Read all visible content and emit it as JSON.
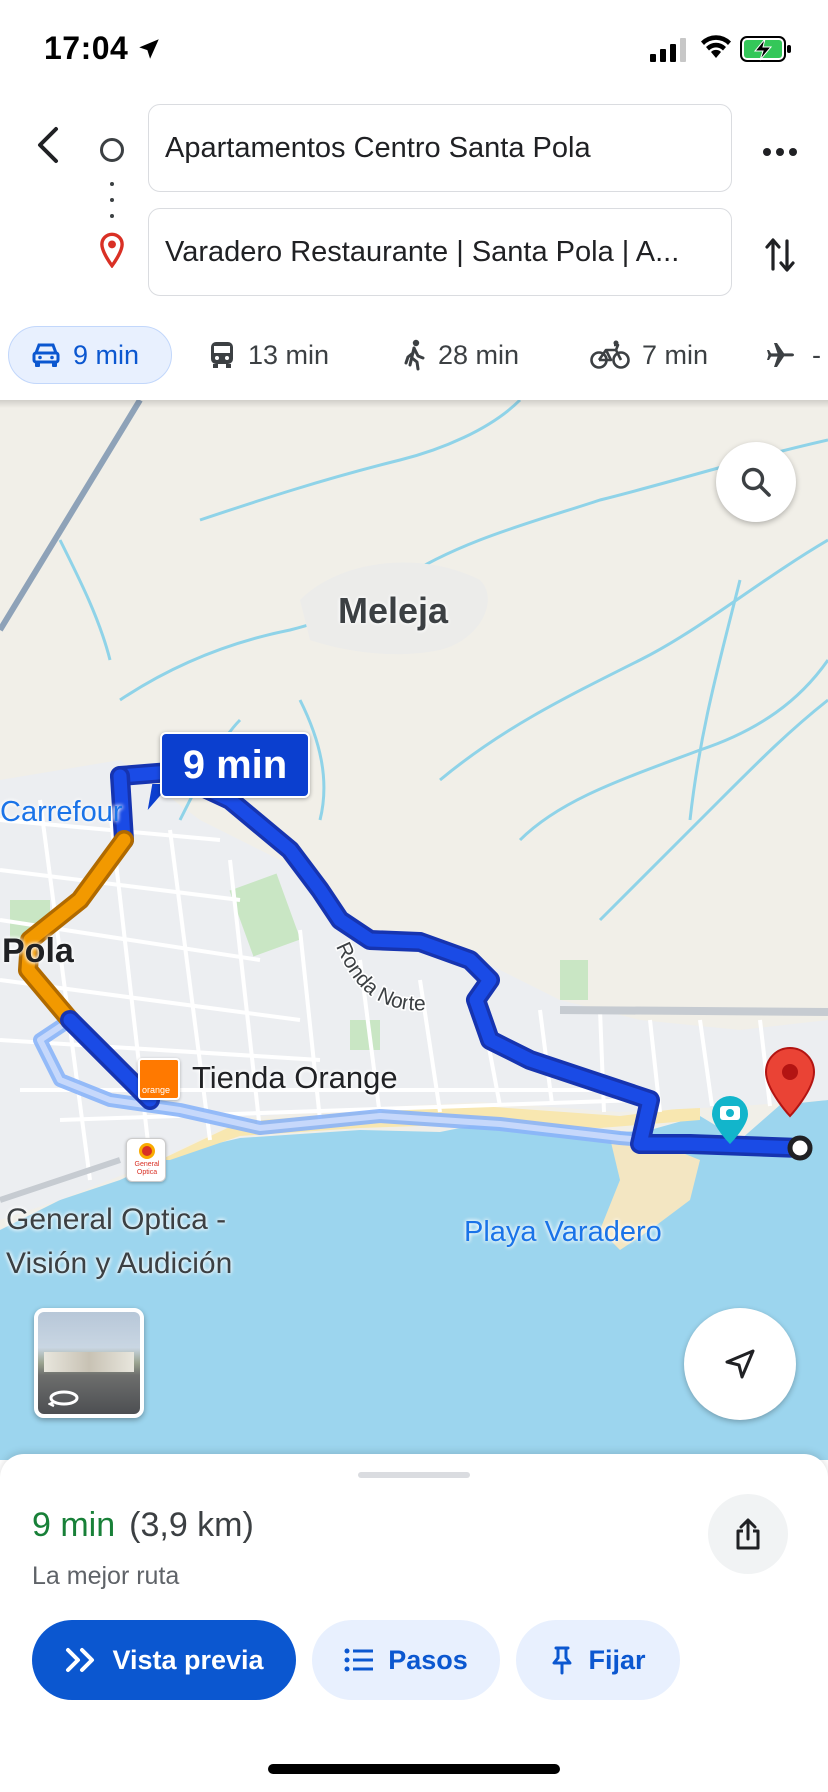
{
  "status_bar": {
    "time": "17:04"
  },
  "search": {
    "origin": "Apartamentos Centro Santa Pola",
    "destination": "Varadero Restaurante | Santa Pola | A..."
  },
  "modes": [
    {
      "name": "car",
      "label": "9 min",
      "selected": true
    },
    {
      "name": "transit",
      "label": "13 min"
    },
    {
      "name": "walk",
      "label": "28 min"
    },
    {
      "name": "bike",
      "label": "7 min"
    },
    {
      "name": "flight",
      "label": "-"
    }
  ],
  "map": {
    "labels": {
      "meleja": "Meleja",
      "pola": "Pola",
      "carrefour": "Carrefour",
      "orange": "Tienda Orange",
      "optica_line1": "General Optica -",
      "optica_line2": "Visión y Audición",
      "varadero": "Playa Varadero",
      "ronda": "Ronda Norte"
    },
    "route_bubble": "9 min"
  },
  "summary": {
    "time": "9 min",
    "distance": "(3,9 km)",
    "note": "La mejor ruta"
  },
  "actions": {
    "preview": "Vista previa",
    "steps": "Pasos",
    "pin": "Fijar"
  },
  "colors": {
    "route_blue": "#1a4be6",
    "traffic_orange": "#f29900",
    "accent": "#0b57d0",
    "eta_green": "#188038"
  }
}
